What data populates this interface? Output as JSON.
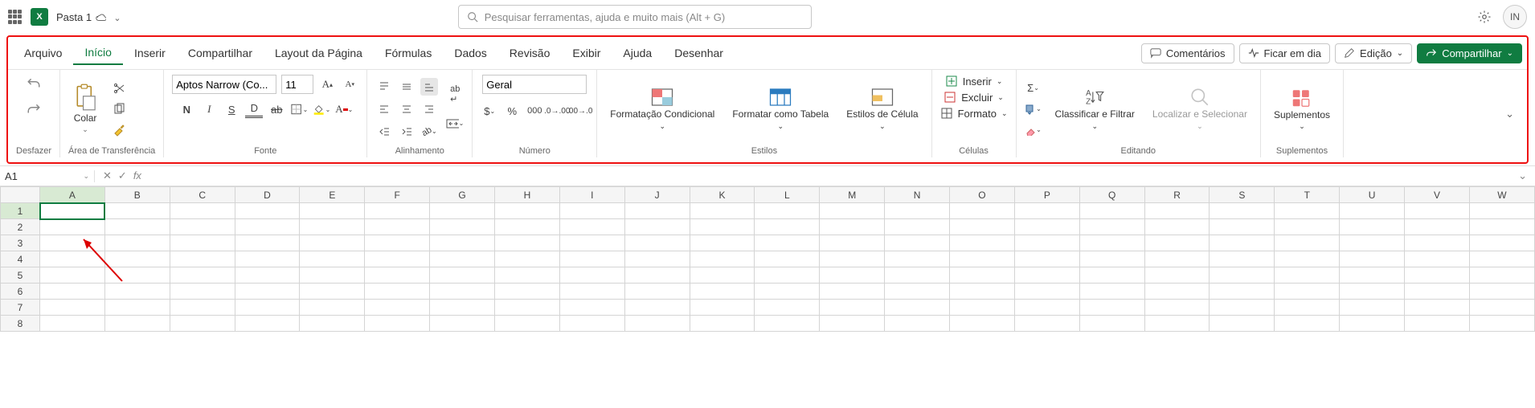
{
  "title": "Pasta 1",
  "search_placeholder": "Pesquisar ferramentas, ajuda e muito mais (Alt + G)",
  "avatar_initials": "IN",
  "tabs": [
    "Arquivo",
    "Início",
    "Inserir",
    "Compartilhar",
    "Layout da Página",
    "Fórmulas",
    "Dados",
    "Revisão",
    "Exibir",
    "Ajuda",
    "Desenhar"
  ],
  "active_tab": "Início",
  "quick_actions": {
    "comments": "Comentários",
    "catchup": "Ficar em dia",
    "editing": "Edição",
    "share": "Compartilhar"
  },
  "ribbon": {
    "undo_label": "Desfazer",
    "clipboard": {
      "paste": "Colar",
      "label": "Área de Transferência"
    },
    "font": {
      "name": "Aptos Narrow (Co...",
      "size": "11",
      "label": "Fonte",
      "bold": "N",
      "italic": "I",
      "under": "S",
      "dunder": "D"
    },
    "align": {
      "label": "Alinhamento"
    },
    "number": {
      "format": "Geral",
      "label": "Número"
    },
    "styles": {
      "cf": "Formatação Condicional",
      "table": "Formatar como Tabela",
      "cell": "Estilos de Célula",
      "label": "Estilos"
    },
    "cells": {
      "insert": "Inserir",
      "delete": "Excluir",
      "format": "Formato",
      "label": "Células"
    },
    "editing": {
      "sort": "Classificar e Filtrar",
      "find": "Localizar e Selecionar",
      "label": "Editando"
    },
    "addins": {
      "addins": "Suplementos",
      "label": "Suplementos"
    }
  },
  "namebox": "A1",
  "columns": [
    "A",
    "B",
    "C",
    "D",
    "E",
    "F",
    "G",
    "H",
    "I",
    "J",
    "K",
    "L",
    "M",
    "N",
    "O",
    "P",
    "Q",
    "R",
    "S",
    "T",
    "U",
    "V",
    "W"
  ],
  "rows": [
    1,
    2,
    3,
    4,
    5,
    6,
    7,
    8
  ],
  "selected_cell": "A1"
}
